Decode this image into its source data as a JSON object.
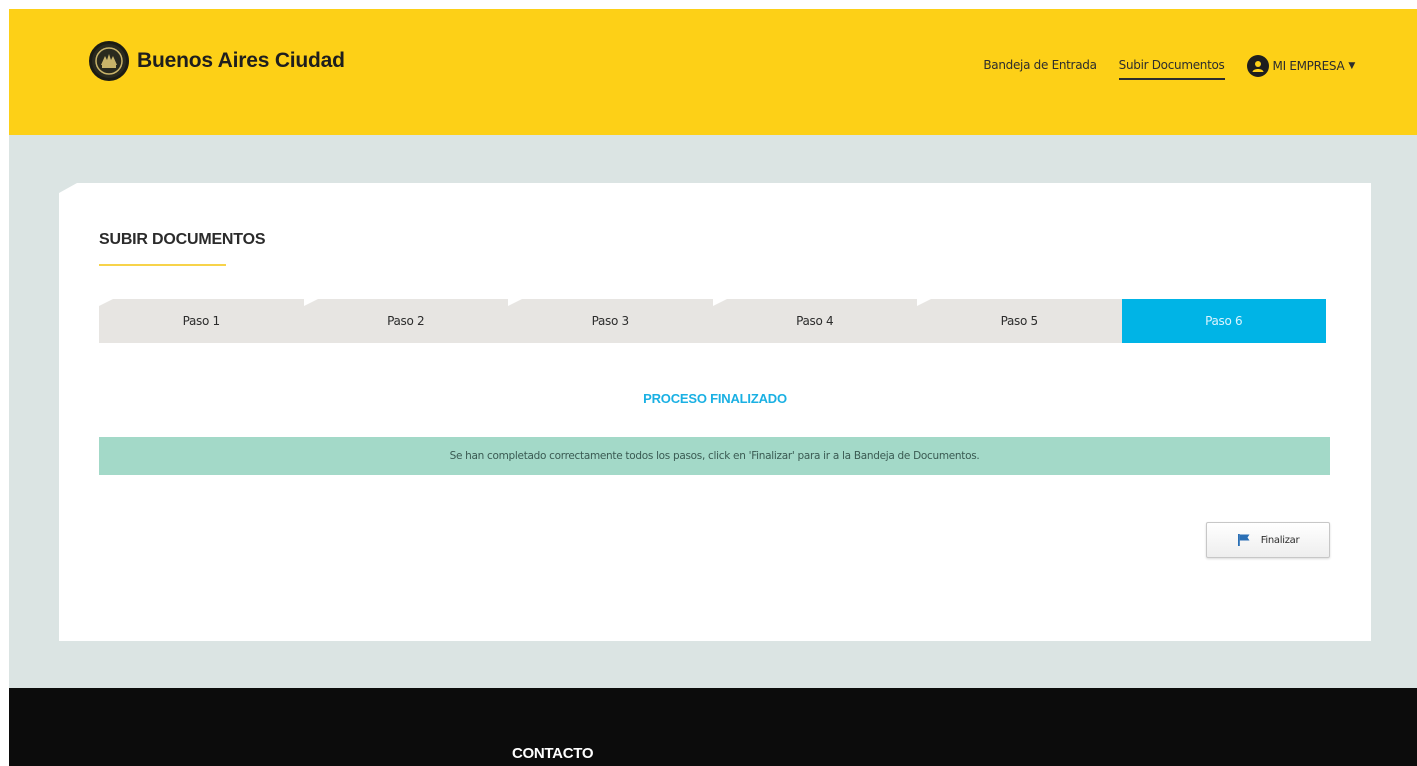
{
  "header": {
    "brand": "Buenos Aires Ciudad",
    "logo_icon": "city-emblem-icon",
    "nav": {
      "inbox": "Bandeja de Entrada",
      "upload": "Subir Documentos",
      "user": "MI EMPRESA"
    },
    "user_icon": "user-avatar-icon",
    "caret_icon": "caret-down-icon"
  },
  "main": {
    "title": "SUBIR DOCUMENTOS",
    "steps": [
      {
        "label": "Paso 1"
      },
      {
        "label": "Paso 2"
      },
      {
        "label": "Paso 3"
      },
      {
        "label": "Paso 4"
      },
      {
        "label": "Paso 5"
      },
      {
        "label": "Paso 6"
      }
    ],
    "current_step": 6,
    "status_title": "PROCESO FINALIZADO",
    "alert": "Se han completado correctamente todos los pasos, click en 'Finalizar' para ir a la Bandeja de Documentos.",
    "finish_button": "Finalizar",
    "finish_icon": "flag-icon"
  },
  "footer": {
    "contact_title": "CONTACTO"
  },
  "colors": {
    "brand_yellow": "#fdd017",
    "active_step": "#00b4e6",
    "alert_bg": "#a3d9c8",
    "status_text": "#1ab0e3",
    "footer_bg": "#0c0c0c"
  }
}
